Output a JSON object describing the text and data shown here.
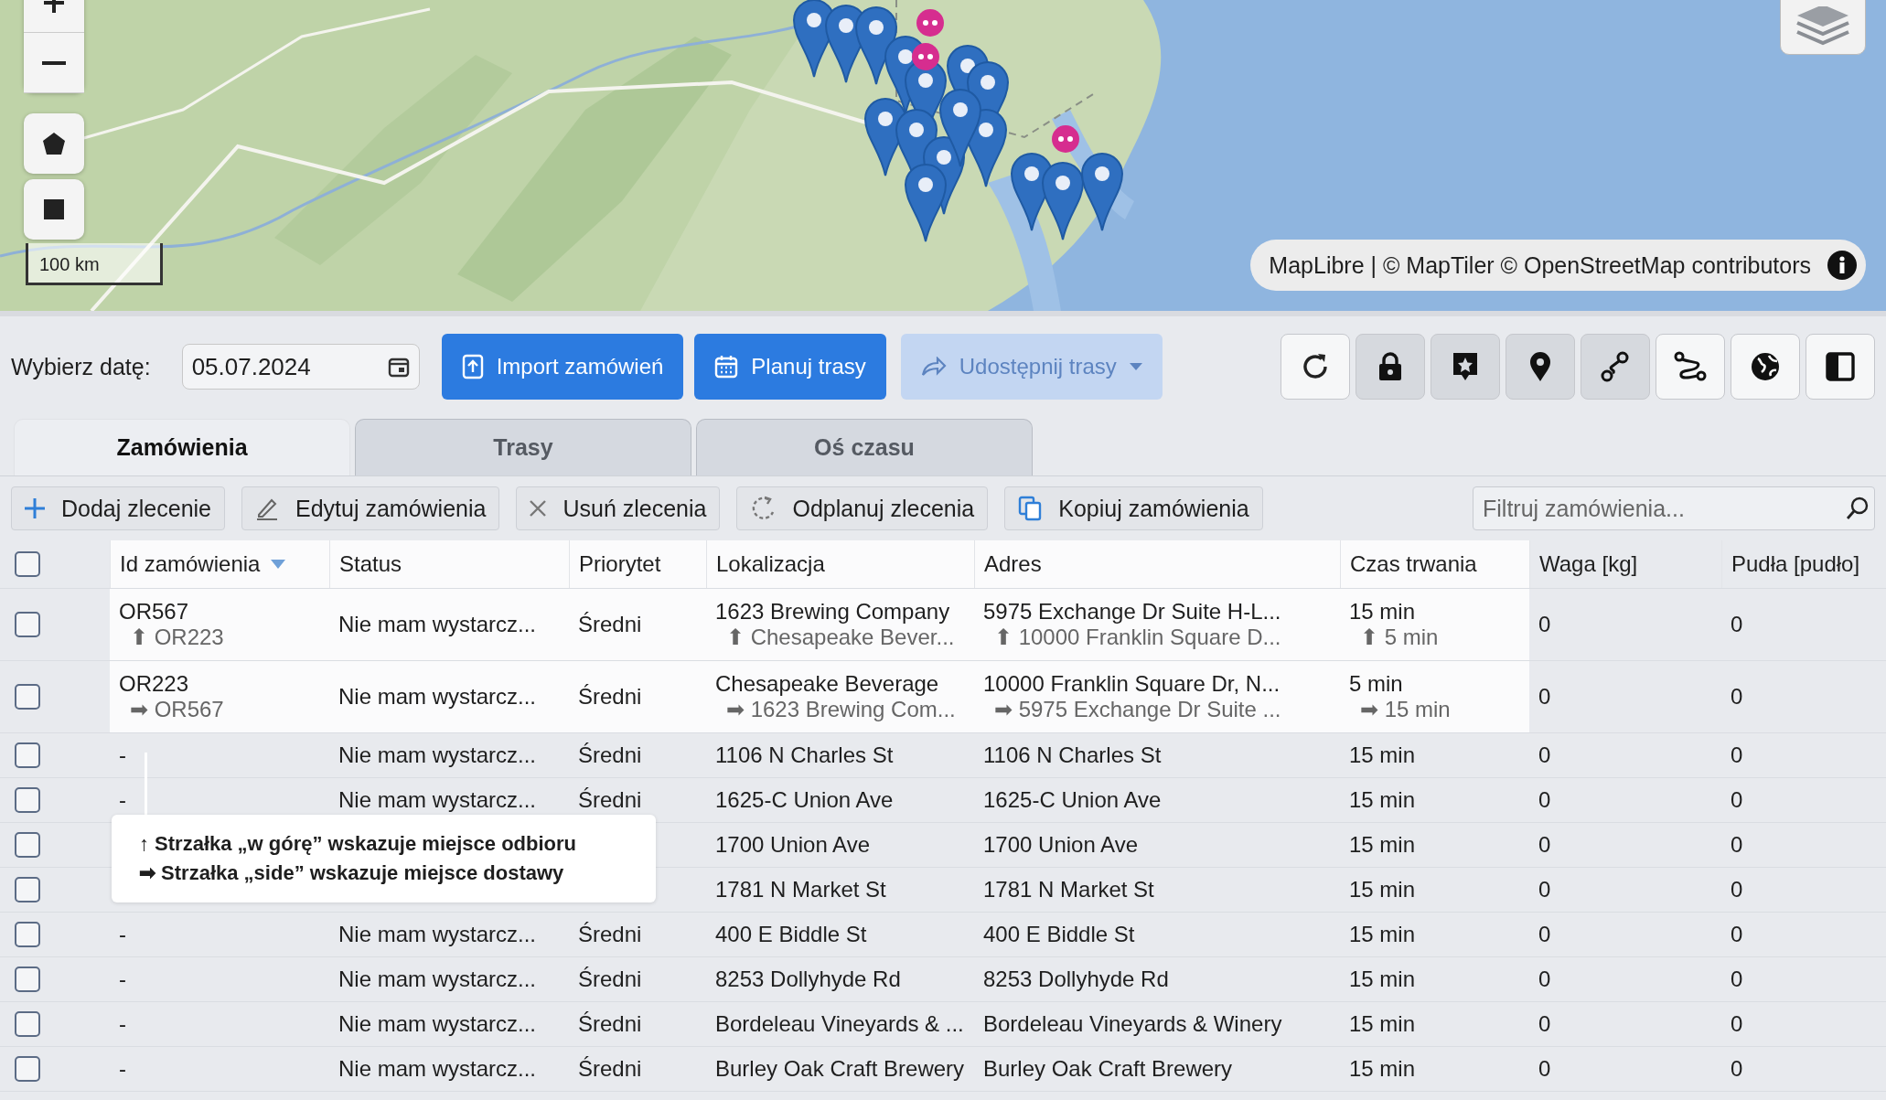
{
  "map": {
    "scale": "100 km",
    "attribution": "MapLibre | © MapTiler © OpenStreetMap contributors"
  },
  "toolbar": {
    "date_label": "Wybierz datę:",
    "date_value": "05.07.2024",
    "buttons": [
      {
        "label": "Import zamówień",
        "kind": "import",
        "disabled": false
      },
      {
        "label": "Planuj trasy",
        "kind": "plan",
        "disabled": false
      },
      {
        "label": "Udostępnij trasy",
        "kind": "share",
        "disabled": true
      }
    ],
    "icon_buttons": [
      {
        "kind": "refresh",
        "active": false
      },
      {
        "kind": "lock",
        "active": true
      },
      {
        "kind": "marker-star",
        "active": true
      },
      {
        "kind": "pin",
        "active": true
      },
      {
        "kind": "route",
        "active": true
      },
      {
        "kind": "route-alt",
        "active": false
      },
      {
        "kind": "globe",
        "active": false
      },
      {
        "kind": "panel",
        "active": false
      }
    ]
  },
  "tabs": [
    {
      "label": "Zamówienia",
      "selected": true
    },
    {
      "label": "Trasy",
      "selected": false
    },
    {
      "label": "Oś czasu",
      "selected": false
    }
  ],
  "actions": [
    {
      "label": "Dodaj zlecenie",
      "kind": "add"
    },
    {
      "label": "Edytuj zamówienia",
      "kind": "edit"
    },
    {
      "label": "Usuń zlecenia",
      "kind": "delete"
    },
    {
      "label": "Odplanuj zlecenia",
      "kind": "unplan"
    },
    {
      "label": "Kopiuj zamówienia",
      "kind": "copy"
    }
  ],
  "filter": {
    "placeholder": "Filtruj zamówienia..."
  },
  "table": {
    "select_all": {
      "checked": false
    },
    "columns": [
      {
        "label": "Id zamówienia",
        "sorted": true
      },
      {
        "label": "Status",
        "sorted": false
      },
      {
        "label": "Priorytet",
        "sorted": false
      },
      {
        "label": "Lokalizacja",
        "sorted": false
      },
      {
        "label": "Adres",
        "sorted": false
      },
      {
        "label": "Czas trwania",
        "sorted": false
      },
      {
        "label": "Waga [kg]",
        "sorted": false
      },
      {
        "label": "Pudła [pudło]",
        "sorted": false
      }
    ],
    "rows": [
      {
        "checked": false,
        "highlighted": true,
        "id": "OR567",
        "id_sub": "⬆ OR223",
        "status": "Nie mam wystarcz...",
        "priority": "Średni",
        "location": "1623 Brewing Company",
        "location_sub": "⬆ Chesapeake Bever...",
        "address": "5975 Exchange Dr Suite H-L...",
        "address_sub": "⬆ 10000 Franklin Square D...",
        "duration": "15 min",
        "duration_sub": "⬆ 5 min",
        "weight": "0",
        "boxes": "0"
      },
      {
        "checked": false,
        "highlighted": true,
        "id": "OR223",
        "id_sub": "➡ OR567",
        "status": "Nie mam wystarcz...",
        "priority": "Średni",
        "location": "Chesapeake Beverage",
        "location_sub": "➡ 1623 Brewing Com...",
        "address": "10000 Franklin Square Dr, N...",
        "address_sub": "➡ 5975 Exchange Dr Suite ...",
        "duration": "5 min",
        "duration_sub": "➡ 15 min",
        "weight": "0",
        "boxes": "0"
      },
      {
        "checked": false,
        "highlighted": false,
        "id": "-",
        "status": "Nie mam wystarcz...",
        "priority": "Średni",
        "location": "1106 N Charles St",
        "address": "1106 N Charles St",
        "duration": "15 min",
        "weight": "0",
        "boxes": "0"
      },
      {
        "checked": false,
        "highlighted": false,
        "id": "-",
        "status": "Nie mam wystarcz...",
        "priority": "Średni",
        "location": "1625-C Union Ave",
        "address": "1625-C Union Ave",
        "duration": "15 min",
        "weight": "0",
        "boxes": "0"
      },
      {
        "checked": false,
        "highlighted": false,
        "location": "1700 Union Ave",
        "address": "1700 Union Ave",
        "duration": "15 min",
        "weight": "0",
        "boxes": "0"
      },
      {
        "checked": false,
        "highlighted": false,
        "location": "1781 N Market St",
        "address": "1781 N Market St",
        "duration": "15 min",
        "weight": "0",
        "boxes": "0"
      },
      {
        "checked": false,
        "highlighted": false,
        "id": "-",
        "status": "Nie mam wystarcz...",
        "priority": "Średni",
        "location": "400 E Biddle St",
        "address": "400 E Biddle St",
        "duration": "15 min",
        "weight": "0",
        "boxes": "0"
      },
      {
        "checked": false,
        "highlighted": false,
        "id": "-",
        "status": "Nie mam wystarcz...",
        "priority": "Średni",
        "location": "8253 Dollyhyde Rd",
        "address": "8253 Dollyhyde Rd",
        "duration": "15 min",
        "weight": "0",
        "boxes": "0"
      },
      {
        "checked": false,
        "highlighted": false,
        "id": "-",
        "status": "Nie mam wystarcz...",
        "priority": "Średni",
        "location": "Bordeleau Vineyards & ...",
        "address": "Bordeleau Vineyards & Winery",
        "duration": "15 min",
        "weight": "0",
        "boxes": "0"
      },
      {
        "checked": false,
        "highlighted": false,
        "id": "-",
        "status": "Nie mam wystarcz...",
        "priority": "Średni",
        "location": "Burley Oak Craft Brewery",
        "address": "Burley Oak Craft Brewery",
        "duration": "15 min",
        "weight": "0",
        "boxes": "0"
      }
    ]
  },
  "tooltip": {
    "lines": [
      "↑ Strzałka „w górę” wskazuje miejsce odbioru",
      "➡ Strzałka „side” wskazuje miejsce dostawy"
    ]
  }
}
